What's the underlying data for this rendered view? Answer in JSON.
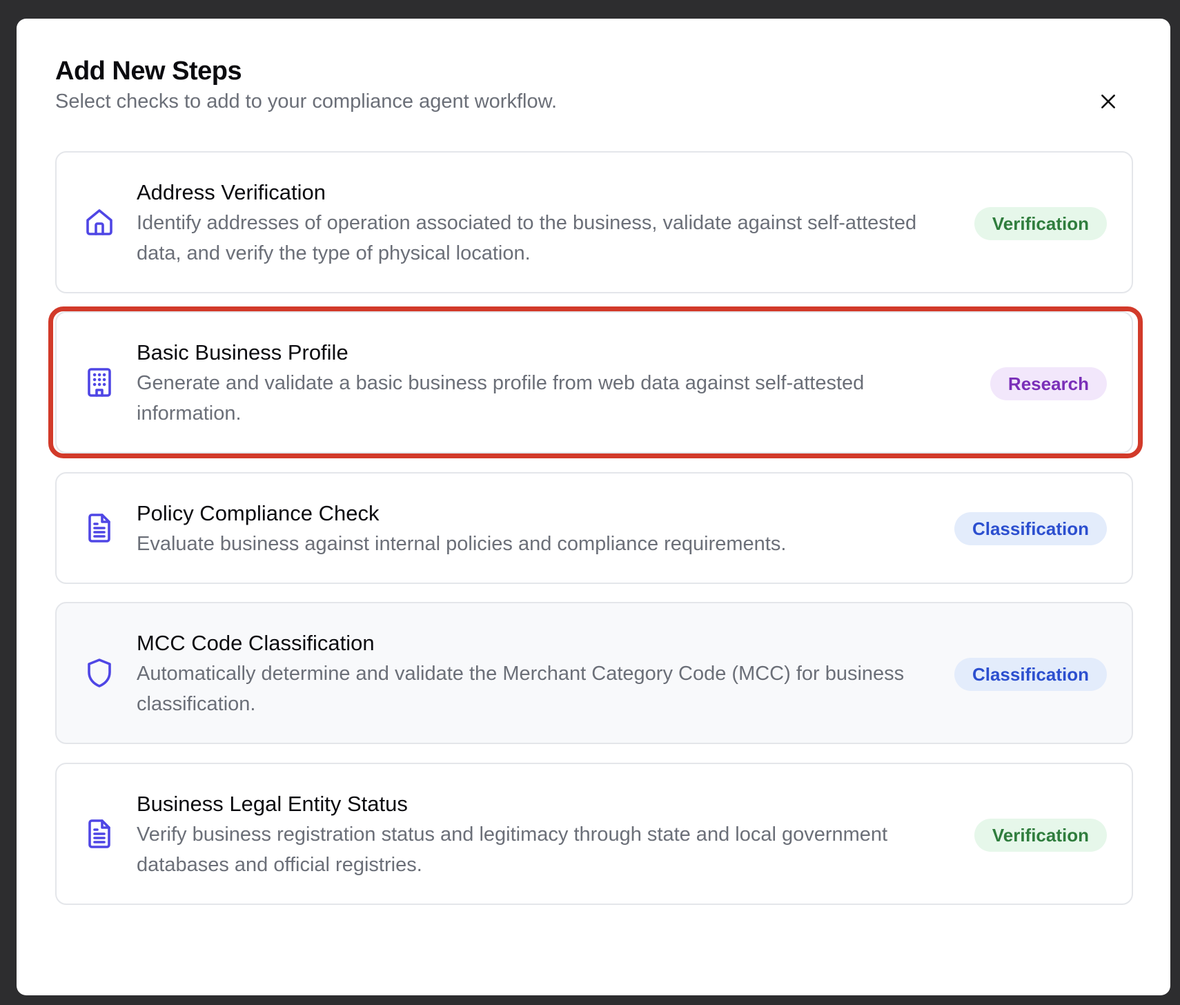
{
  "modal": {
    "title": "Add New Steps",
    "subtitle": "Select checks to add to your compliance agent workflow."
  },
  "colors": {
    "icon": "#4f46e5",
    "highlight": "#d23a2a",
    "verification_bg": "#e6f7ea",
    "verification_text": "#2f7d3d",
    "research_bg": "#f2e7fb",
    "research_text": "#7a2fb8",
    "classification_bg": "#e3ecfb",
    "classification_text": "#2c4fcf"
  },
  "steps": [
    {
      "icon": "home-icon",
      "title": "Address Verification",
      "description": "Identify addresses of operation associated to the business, validate against self-attested data, and verify the type of physical location.",
      "badge": "Verification"
    },
    {
      "icon": "building-icon",
      "title": "Basic Business Profile",
      "description": "Generate and validate a basic business profile from web data against self-attested information.",
      "badge": "Research",
      "highlighted": true
    },
    {
      "icon": "document-icon",
      "title": "Policy Compliance Check",
      "description": "Evaluate business against internal policies and compliance requirements.",
      "badge": "Classification"
    },
    {
      "icon": "shield-icon",
      "title": "MCC Code Classification",
      "description": "Automatically determine and validate the Merchant Category Code (MCC) for business classification.",
      "badge": "Classification",
      "hovered": true
    },
    {
      "icon": "document-icon",
      "title": "Business Legal Entity Status",
      "description": "Verify business registration status and legitimacy through state and local government databases and official registries.",
      "badge": "Verification"
    }
  ]
}
